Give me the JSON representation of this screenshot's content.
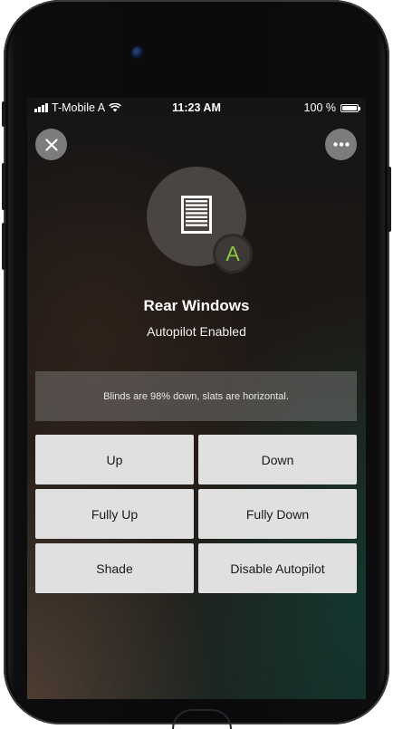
{
  "status_bar": {
    "carrier": "T-Mobile A",
    "time": "11:23 AM",
    "battery": "100 %",
    "battery_level": 1.0,
    "signal_icon": "cellular-signal-icon",
    "wifi_icon": "wifi-icon",
    "battery_icon": "battery-icon"
  },
  "toolbar": {
    "close_icon": "close-icon",
    "more_icon": "more-options-icon"
  },
  "device": {
    "icon": "window-blind-icon",
    "badge_letter": "A",
    "badge_color": "#8dc63f",
    "name": "Rear Windows",
    "mode": "Autopilot Enabled"
  },
  "status_message": "Blinds are 98% down, slats are horizontal.",
  "controls": {
    "up": "Up",
    "down": "Down",
    "fully_up": "Fully Up",
    "fully_down": "Fully Down",
    "shade": "Shade",
    "disable_autopilot": "Disable Autopilot"
  },
  "colors": {
    "button_bg": "#e0e0e0",
    "accent_green": "#8dc63f"
  }
}
